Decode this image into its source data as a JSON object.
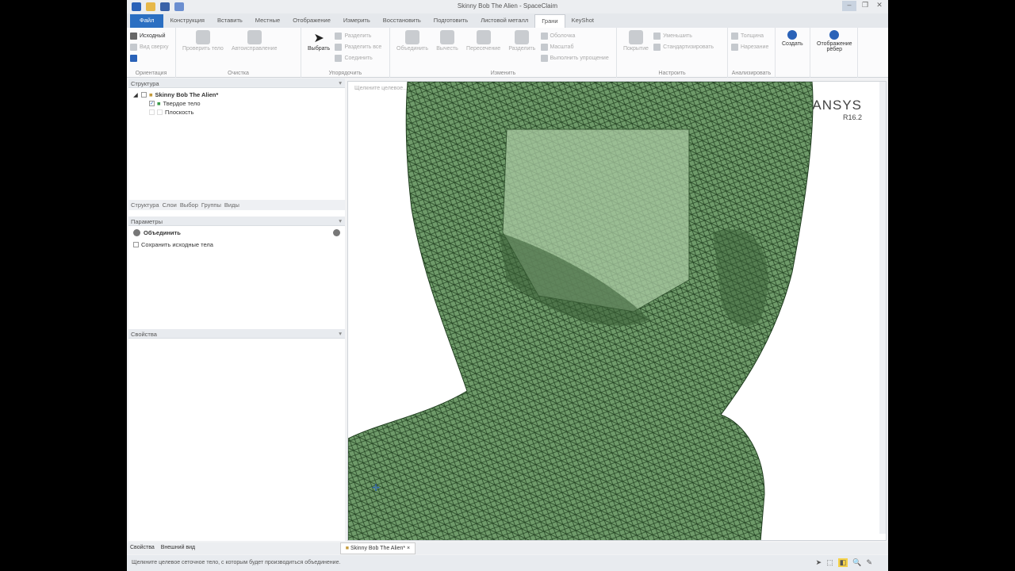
{
  "window": {
    "title": "Skinny Bob The Alien - SpaceClaim"
  },
  "tabs": [
    {
      "label": "Файл"
    },
    {
      "label": "Конструкция"
    },
    {
      "label": "Вставить"
    },
    {
      "label": "Местные"
    },
    {
      "label": "Отображение"
    },
    {
      "label": "Измерить"
    },
    {
      "label": "Восстановить"
    },
    {
      "label": "Подготовить"
    },
    {
      "label": "Листовой металл"
    },
    {
      "label": "Грани"
    },
    {
      "label": "KeyShot"
    }
  ],
  "active_tab": "Грани",
  "ribbon": {
    "orientation": {
      "label": "Ориентация",
      "home": "Исходный",
      "top_view": "Вид сверху"
    },
    "cleanup": {
      "label": "Очистка",
      "check": "Проверить тело",
      "autofix": "Автоисправление"
    },
    "arrange": {
      "label": "Упорядочить",
      "select": "Выбрать",
      "split": "Разделить",
      "split_all": "Разделить все",
      "join": "Соединить"
    },
    "modify": {
      "label": "Изменить",
      "merge": "Объединить",
      "subtract": "Вычесть",
      "intersect": "Пересечение",
      "split": "Разделить",
      "shell": "Оболочка",
      "scale": "Масштаб",
      "simplify": "Выполнить упрощение"
    },
    "adjust": {
      "label": "Настроить",
      "cover": "Покрытие",
      "reduce": "Уменьшить",
      "standardize": "Стандартизировать"
    },
    "analyze": {
      "label": "Анализировать",
      "thickness": "Толщина",
      "cut": "Нарезание"
    },
    "create": "Создать",
    "edge_display": "Отображение рёбер"
  },
  "structure": {
    "title": "Структура",
    "root": "Skinny Bob The Alien*",
    "items": [
      "Твердое тело",
      "Плоскость"
    ]
  },
  "panel_tabs": [
    "Структура",
    "Слои",
    "Выбор",
    "Группы",
    "Виды"
  ],
  "options": {
    "title": "Параметры",
    "tool": "Объединить",
    "keep_original": "Сохранить исходные тела"
  },
  "properties": {
    "title": "Свойства"
  },
  "bottom_left_tabs": [
    "Свойства",
    "Внешний вид"
  ],
  "viewport": {
    "hint": "Щелкните целевое...",
    "doc_tab": "Skinny Bob The Alien*",
    "brand": "ANSYS",
    "version": "R16.2",
    "mesh_color": "#5e8f5c"
  },
  "status": {
    "text": "Щелкните целевое сеточное тело, с которым будет производиться объединение."
  }
}
